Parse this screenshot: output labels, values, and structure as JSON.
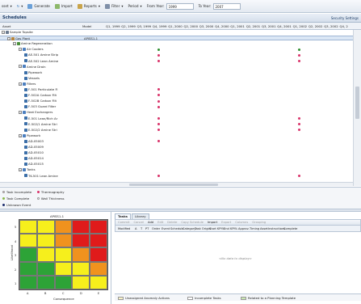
{
  "toolbar": {
    "asset_label": "sset",
    "generate_label": "Generate",
    "import_label": "Import",
    "reports_label": "Reports",
    "filter_label": "Filter",
    "period_label": "Period",
    "from_year_label": "From Year:",
    "from_year_value": "1999",
    "to_year_label": "To Year:",
    "to_year_value": "2007"
  },
  "panel": {
    "title": "Schedules",
    "security_label": "Security Settings"
  },
  "columns": {
    "asset": "Asset",
    "model": "Model",
    "quarters": [
      "Q1, 1999",
      "Q2, 1999",
      "Q3, 1999",
      "Q4, 1999",
      "Q1, 2000",
      "Q2, 2000",
      "Q3, 2000",
      "Q4, 2000",
      "Q1, 2001",
      "Q2, 2001",
      "Q3, 2001",
      "Q4, 2001",
      "Q1, 2002",
      "Q2, 2002",
      "Q3, 2002",
      "Q4, 2"
    ]
  },
  "tree": [
    {
      "label": "Sample Topsite",
      "level": 0,
      "model": "",
      "marks": []
    },
    {
      "label": "Gas Plant",
      "level": 1,
      "model": "APISS1-1",
      "selected": true,
      "marks": []
    },
    {
      "label": "Amine Regeneration",
      "level": 2,
      "model": "",
      "marks": []
    },
    {
      "label": "Air Coolers",
      "level": 3,
      "model": "",
      "marks": [
        {
          "col": 3,
          "status": "green"
        },
        {
          "col": 12,
          "status": "green"
        }
      ]
    },
    {
      "label": "AE-501 Amine Strip",
      "level": 4,
      "model": "",
      "marks": [
        {
          "col": 3,
          "status": "red"
        },
        {
          "col": 12,
          "status": "red"
        }
      ]
    },
    {
      "label": "AE-502 Lean Amine",
      "level": 4,
      "model": "",
      "marks": [
        {
          "col": 3,
          "status": "red"
        },
        {
          "col": 12,
          "status": "red"
        }
      ]
    },
    {
      "label": "Amine Drain",
      "level": 3,
      "model": "",
      "marks": []
    },
    {
      "label": "Pipework",
      "level": 4,
      "model": "",
      "marks": []
    },
    {
      "label": "Vessels",
      "level": 4,
      "model": "",
      "marks": []
    },
    {
      "label": "Filters",
      "level": 3,
      "model": "",
      "marks": []
    },
    {
      "label": "F-501 Particulate Fi",
      "level": 4,
      "model": "",
      "marks": [
        {
          "col": 3,
          "status": "red"
        }
      ]
    },
    {
      "label": "F-502A Carbon Filt",
      "level": 4,
      "model": "",
      "marks": [
        {
          "col": 3,
          "status": "red"
        }
      ]
    },
    {
      "label": "F-502B Carbon Filt",
      "level": 4,
      "model": "",
      "marks": [
        {
          "col": 3,
          "status": "red"
        }
      ]
    },
    {
      "label": "F-503 Guard Filter",
      "level": 4,
      "model": "",
      "marks": [
        {
          "col": 3,
          "status": "red"
        }
      ]
    },
    {
      "label": "Heat Exchangers",
      "level": 3,
      "model": "",
      "marks": []
    },
    {
      "label": "E-501 Lean/Rich Ar",
      "level": 4,
      "model": "",
      "marks": [
        {
          "col": 3,
          "status": "red"
        },
        {
          "col": 12,
          "status": "red"
        }
      ]
    },
    {
      "label": "E-502/1 Amine Stri",
      "level": 4,
      "model": "",
      "marks": [
        {
          "col": 3,
          "status": "red"
        },
        {
          "col": 12,
          "status": "red"
        }
      ]
    },
    {
      "label": "E-502/2 Amine Stri",
      "level": 4,
      "model": "",
      "marks": [
        {
          "col": 3,
          "status": "red"
        },
        {
          "col": 12,
          "status": "red"
        }
      ]
    },
    {
      "label": "Pipework",
      "level": 3,
      "model": "",
      "marks": []
    },
    {
      "label": "AD-05003",
      "level": 4,
      "model": "",
      "marks": [
        {
          "col": 3,
          "status": "red"
        }
      ]
    },
    {
      "label": "AD-05009",
      "level": 4,
      "model": "",
      "marks": []
    },
    {
      "label": "AD-05010",
      "level": 4,
      "model": "",
      "marks": []
    },
    {
      "label": "AD-05014",
      "level": 4,
      "model": "",
      "marks": []
    },
    {
      "label": "AD-05015",
      "level": 4,
      "model": "",
      "marks": []
    },
    {
      "label": "Tanks",
      "level": 3,
      "model": "",
      "marks": []
    },
    {
      "label": "TK-501 Lean Amine",
      "level": 4,
      "model": "",
      "marks": [
        {
          "col": 3,
          "status": "red"
        },
        {
          "col": 12,
          "status": "red"
        }
      ]
    }
  ],
  "legend": [
    {
      "label": "Task Incomplete",
      "color": "#e8b8c0"
    },
    {
      "label": "Thermography",
      "color": "#d9336a"
    },
    {
      "label": "Task Complete",
      "color": "#8ab84a"
    },
    {
      "label": "Wall Thickness",
      "color": "#ffffff"
    },
    {
      "label": "Unknown Event",
      "color": "#1a2b6b"
    }
  ],
  "matrix": {
    "title": "APISS1-1",
    "y_axis_label": "Likelihood",
    "x_axis_label": "Consequence",
    "y_ticks": [
      "5",
      "4",
      "3",
      "2",
      "1"
    ],
    "x_ticks": [
      "A",
      "B",
      "C",
      "D",
      "E"
    ],
    "rows": [
      [
        "#f6ef1c",
        "#f6ef1c",
        "#f0921e",
        "#e01b1b",
        "#e01b1b"
      ],
      [
        "#f6ef1c",
        "#f6ef1c",
        "#f0921e",
        "#e01b1b",
        "#e01b1b"
      ],
      [
        "#2da337",
        "#f6ef1c",
        "#f6ef1c",
        "#f0921e",
        "#e01b1b"
      ],
      [
        "#2da337",
        "#2da337",
        "#f6ef1c",
        "#f6ef1c",
        "#f0921e"
      ],
      [
        "#2da337",
        "#2da337",
        "#2da337",
        "#f6ef1c",
        "#f6ef1c"
      ]
    ]
  },
  "tasks_panel": {
    "tabs": [
      "Tasks",
      "Library"
    ],
    "tools": [
      "Commit",
      "Cancel",
      "Add",
      "Edit",
      "Delete",
      "Copy Schedule",
      "Import",
      "Export",
      "Columns",
      "Grouping"
    ],
    "table_headers": [
      "Modified",
      "A",
      "T",
      "PT",
      "Order",
      "Event",
      "Schedule",
      "Category",
      "Task Origin",
      "Start KPI%",
      "End KPI%",
      "Approv.",
      "Timing",
      "Asset",
      "Instructions",
      "Complete"
    ],
    "empty_message": "<No data to display>",
    "status": [
      {
        "label": "Unassigned Anomaly Actions",
        "color": "#f8f2c8"
      },
      {
        "label": "Incomplete Tasks",
        "color": "#ffffff"
      },
      {
        "label": "Related to a Planning Template",
        "color": "#c8e6b0"
      }
    ]
  },
  "colors": {
    "mark_red": "#d9336a",
    "mark_green": "#2f8f2f"
  }
}
